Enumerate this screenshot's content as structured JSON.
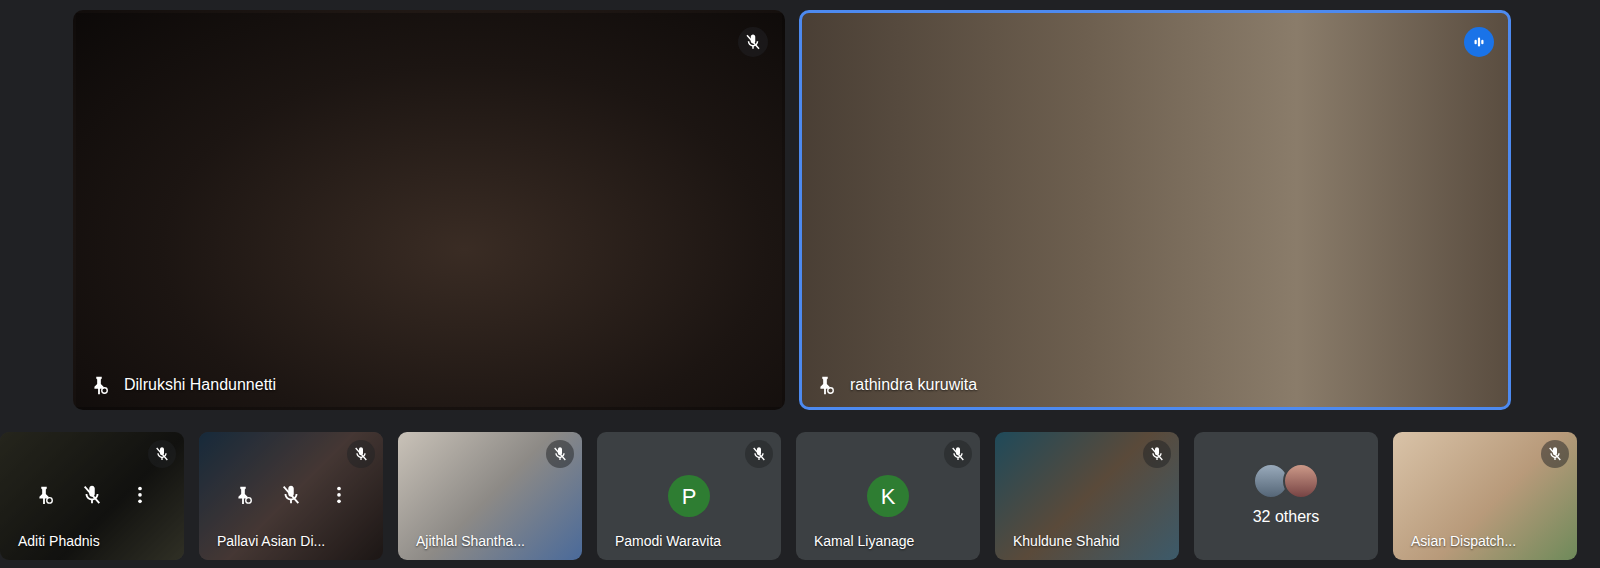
{
  "main_tiles": [
    {
      "name": "Dilrukshi Handunnetti",
      "muted": true,
      "speaking": false,
      "pinned": true
    },
    {
      "name": "rathindra kuruwita",
      "muted": false,
      "speaking": true,
      "pinned": true
    }
  ],
  "strip_tiles": [
    {
      "kind": "video",
      "name": "Aditi Phadnis",
      "muted": true,
      "controls_shown": true
    },
    {
      "kind": "video",
      "name": "Pallavi Asian Di...",
      "muted": true,
      "controls_shown": true
    },
    {
      "kind": "video",
      "name": "Ajithlal Shantha...",
      "muted": true,
      "controls_shown": false
    },
    {
      "kind": "avatar",
      "name": "Pamodi Waravita",
      "initial": "P",
      "muted": true,
      "controls_shown": false
    },
    {
      "kind": "avatar",
      "name": "Kamal Liyanage",
      "initial": "K",
      "muted": true,
      "controls_shown": false
    },
    {
      "kind": "video",
      "name": "Khuldune Shahid",
      "muted": true,
      "controls_shown": false
    },
    {
      "kind": "others",
      "name": "32 others",
      "muted": false,
      "controls_shown": false
    },
    {
      "kind": "video",
      "name": "Asian Dispatch...",
      "muted": true,
      "controls_shown": false
    }
  ]
}
